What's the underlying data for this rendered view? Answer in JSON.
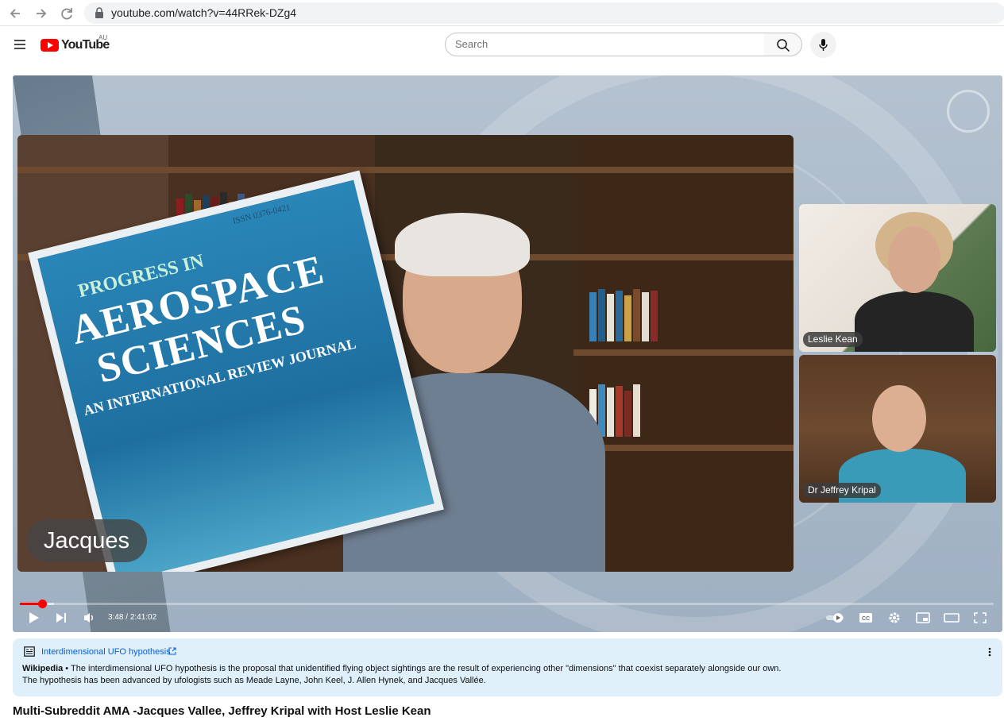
{
  "browser": {
    "url": "youtube.com/watch?v=44RRek-DZg4"
  },
  "header": {
    "logo_text": "YouTube",
    "country_code": "AU",
    "search_placeholder": "Search"
  },
  "player": {
    "participants": [
      {
        "name": "Jacques"
      },
      {
        "name": "Leslie Kean"
      },
      {
        "name": "Dr Jeffrey Kripal"
      }
    ],
    "journal": {
      "issn": "ISSN 0376-0421",
      "line1": "PROGRESS IN",
      "line2": "AEROSPACE",
      "line3": "SCIENCES",
      "line4": "AN INTERNATIONAL REVIEW JOURNAL"
    },
    "time_current": "3:48",
    "time_separator": " / ",
    "time_total": "2:41:02",
    "progress_fraction": 0.023,
    "buffered_fraction": 0.035
  },
  "info_panel": {
    "title": "Interdimensional UFO hypothesis",
    "source": "Wikipedia",
    "bullet": " • ",
    "line1": "The interdimensional UFO hypothesis is the proposal that unidentified flying object sightings are the result of experiencing other \"dimensions\" that coexist separately alongside our own.",
    "line2": "The hypothesis has been advanced by ufologists such as Meade Layne, John Keel, J. Allen Hynek, and Jacques Vallée."
  },
  "video": {
    "title": "Multi-Subreddit AMA -Jacques Vallee, Jeffrey Kripal with Host Leslie Kean"
  },
  "colors": {
    "accent": "#ff0000",
    "link": "#065fd4",
    "info_bg": "#dff0fb"
  },
  "icons": [
    "back-arrow-icon",
    "forward-arrow-icon",
    "reload-icon",
    "lock-icon",
    "menu-icon",
    "search-icon",
    "mic-icon",
    "play-icon",
    "next-icon",
    "volume-icon",
    "autoplay-toggle-icon",
    "captions-icon",
    "settings-icon",
    "miniplayer-icon",
    "theater-icon",
    "fullscreen-icon",
    "info-panel-icon",
    "external-link-icon",
    "more-vert-icon"
  ]
}
